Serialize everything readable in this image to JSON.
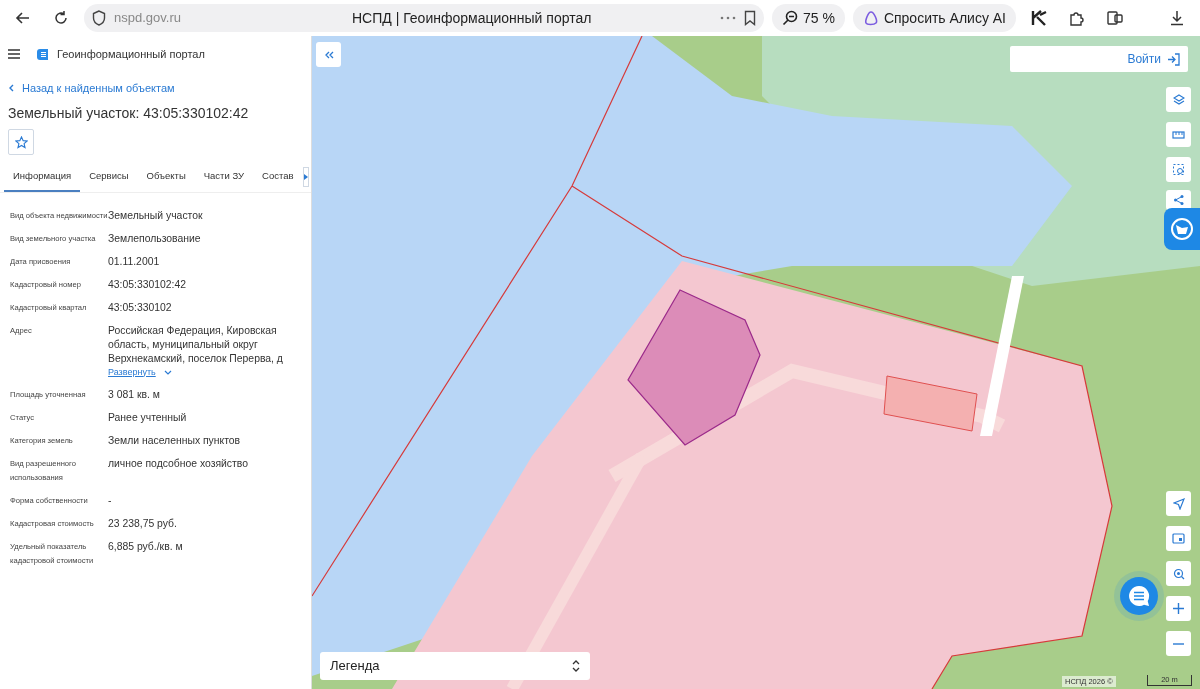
{
  "browser": {
    "url": "nspd.gov.ru",
    "title": "НСПД | Геоинформационный портал",
    "zoom": "75 %",
    "assistant": "Спросить Алису AI"
  },
  "portal": {
    "title": "Геоинформационный портал"
  },
  "back_link": "Назад к найденным объектам",
  "heading": "Земельный участок: 43:05:330102:42",
  "tabs": [
    {
      "label": "Информация",
      "selected": true
    },
    {
      "label": "Сервисы",
      "selected": false
    },
    {
      "label": "Объекты",
      "selected": false
    },
    {
      "label": "Части ЗУ",
      "selected": false
    },
    {
      "label": "Состав",
      "selected": false
    }
  ],
  "properties": [
    {
      "label": "Вид объекта недвижимости",
      "value": "Земельный участок"
    },
    {
      "label": "Вид земельного участка",
      "value": "Землепользование"
    },
    {
      "label": "Дата присвоения",
      "value": "01.11.2001"
    },
    {
      "label": "Кадастровый номер",
      "value": "43:05:330102:42"
    },
    {
      "label": "Кадастровый квартал",
      "value": "43:05:330102"
    },
    {
      "label": "Адрес",
      "value": "Российская Федерация, Кировская область, муниципальный округ Верхнекамский, поселок Перерва, д",
      "expand_link": "Развернуть"
    },
    {
      "label": "Площадь уточненная",
      "value": "3 081 кв. м"
    },
    {
      "label": "Статус",
      "value": "Ранее учтенный"
    },
    {
      "label": "Категория земель",
      "value": "Земли населенных пунктов"
    },
    {
      "label": "Вид разрешенного использования",
      "value": "личное подсобное хозяйство"
    },
    {
      "label": "Форма собственности",
      "value": "-"
    },
    {
      "label": "Кадастровая стоимость",
      "value": "23 238,75 руб."
    },
    {
      "label": "Удельный показатель кадастровой стоимости",
      "value": "6,885 руб./кв. м"
    }
  ],
  "map": {
    "login": "Войти",
    "legend": "Легенда",
    "attribution": "НСПД 2026 ©",
    "scale": "20 m"
  }
}
